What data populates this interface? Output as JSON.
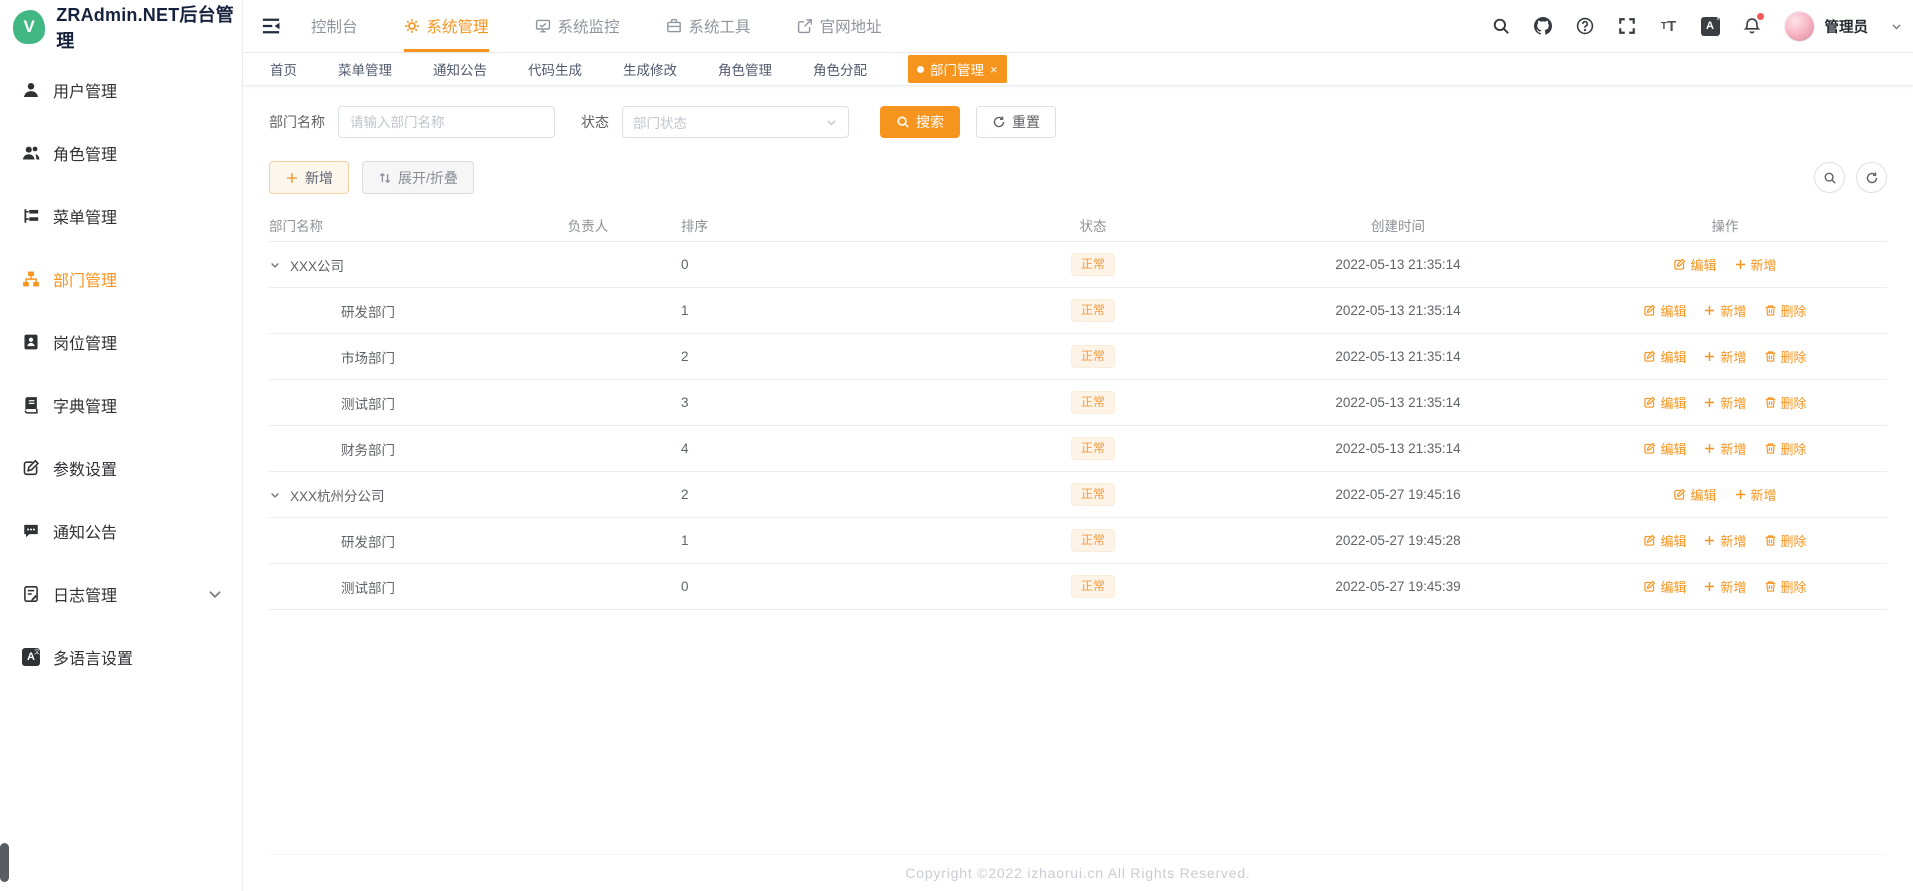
{
  "app": {
    "title": "ZRAdmin.NET后台管理",
    "logo_letter": "V",
    "logo_color": "#41b883",
    "accent_color": "#f7941e"
  },
  "sidebar": {
    "items": [
      {
        "label": "用户管理",
        "icon": "user-icon",
        "active": false
      },
      {
        "label": "角色管理",
        "icon": "roles-icon",
        "active": false
      },
      {
        "label": "菜单管理",
        "icon": "menu-tree-icon",
        "active": false
      },
      {
        "label": "部门管理",
        "icon": "org-chart-icon",
        "active": true
      },
      {
        "label": "岗位管理",
        "icon": "badge-icon",
        "active": false
      },
      {
        "label": "字典管理",
        "icon": "book-icon",
        "active": false
      },
      {
        "label": "参数设置",
        "icon": "edit-square-icon",
        "active": false
      },
      {
        "label": "通知公告",
        "icon": "chat-bubble-icon",
        "active": false
      },
      {
        "label": "日志管理",
        "icon": "log-doc-icon",
        "active": false,
        "has_children": true
      },
      {
        "label": "多语言设置",
        "icon": "language-icon",
        "active": false
      }
    ]
  },
  "topnav": {
    "items": [
      {
        "label": "控制台",
        "active": false
      },
      {
        "label": "系统管理",
        "icon": "gear-icon",
        "active": true
      },
      {
        "label": "系统监控",
        "icon": "monitor-icon",
        "active": false
      },
      {
        "label": "系统工具",
        "icon": "toolbox-icon",
        "active": false
      },
      {
        "label": "官网地址",
        "icon": "external-link-icon",
        "active": false
      }
    ],
    "user": {
      "name": "管理员"
    },
    "notification_dot": true
  },
  "tabs": {
    "items": [
      {
        "label": "首页"
      },
      {
        "label": "菜单管理"
      },
      {
        "label": "通知公告"
      },
      {
        "label": "代码生成"
      },
      {
        "label": "生成修改"
      },
      {
        "label": "角色管理"
      },
      {
        "label": "角色分配"
      },
      {
        "label": "部门管理",
        "active": true,
        "closable": true
      }
    ],
    "close_glyph": "×"
  },
  "filters": {
    "name_label": "部门名称",
    "name_placeholder": "请输入部门名称",
    "name_value": "",
    "status_label": "状态",
    "status_placeholder": "部门状态",
    "search_label": "搜索",
    "reset_label": "重置"
  },
  "toolbar": {
    "add_label": "新增",
    "toggle_label": "展开/折叠"
  },
  "table": {
    "headers": [
      "部门名称",
      "负责人",
      "排序",
      "状态",
      "创建时间",
      "操作"
    ],
    "actions": {
      "edit": "编辑",
      "add": "新增",
      "delete": "删除"
    },
    "rows": [
      {
        "name": "XXX公司",
        "is_child": false,
        "leader": "",
        "sort": "0",
        "status": "正常",
        "created": "2022-05-13 21:35:14",
        "deletable": false
      },
      {
        "name": "研发部门",
        "is_child": true,
        "leader": "",
        "sort": "1",
        "status": "正常",
        "created": "2022-05-13 21:35:14",
        "deletable": true
      },
      {
        "name": "市场部门",
        "is_child": true,
        "leader": "",
        "sort": "2",
        "status": "正常",
        "created": "2022-05-13 21:35:14",
        "deletable": true
      },
      {
        "name": "测试部门",
        "is_child": true,
        "leader": "",
        "sort": "3",
        "status": "正常",
        "created": "2022-05-13 21:35:14",
        "deletable": true
      },
      {
        "name": "财务部门",
        "is_child": true,
        "leader": "",
        "sort": "4",
        "status": "正常",
        "created": "2022-05-13 21:35:14",
        "deletable": true
      },
      {
        "name": "XXX杭州分公司",
        "is_child": false,
        "leader": "",
        "sort": "2",
        "status": "正常",
        "created": "2022-05-27 19:45:16",
        "deletable": false
      },
      {
        "name": "研发部门",
        "is_child": true,
        "leader": "",
        "sort": "1",
        "status": "正常",
        "created": "2022-05-27 19:45:28",
        "deletable": true
      },
      {
        "name": "测试部门",
        "is_child": true,
        "leader": "",
        "sort": "0",
        "status": "正常",
        "created": "2022-05-27 19:45:39",
        "deletable": true
      }
    ]
  },
  "footer": {
    "copyright": "Copyright ©2022 izhaorui.cn All Rights Reserved."
  }
}
